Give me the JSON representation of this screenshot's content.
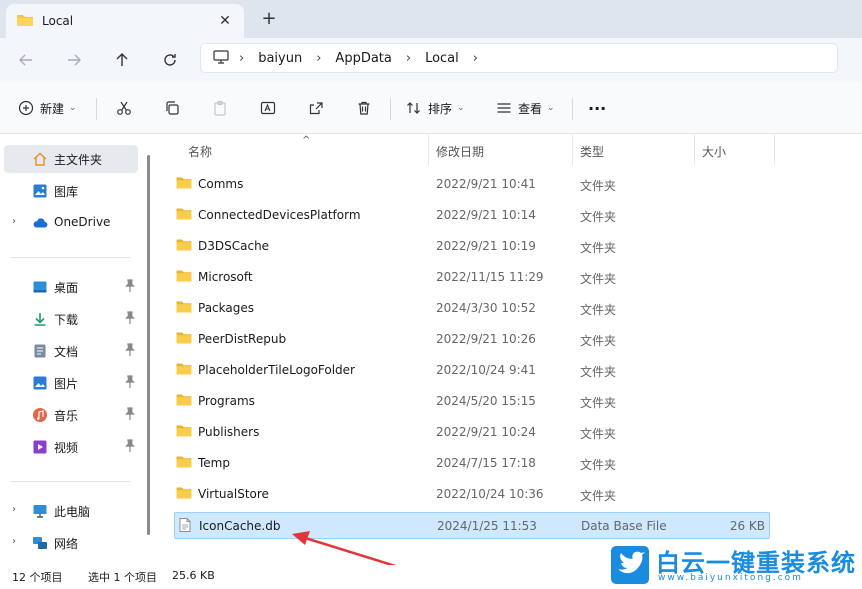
{
  "window": {
    "tab_title": "Local",
    "close_glyph": "✕",
    "new_tab_glyph": "+"
  },
  "address": {
    "crumbs": [
      "baiyun",
      "AppData",
      "Local"
    ],
    "sep": "›"
  },
  "toolbar": {
    "new_label": "新建",
    "sort_label": "排序",
    "view_label": "查看",
    "more_glyph": "···",
    "caret": "⌄"
  },
  "sidebar": {
    "home_label": "主文件夹",
    "gallery_label": "图库",
    "onedrive_label": "OneDrive",
    "desktop_label": "桌面",
    "downloads_label": "下载",
    "documents_label": "文档",
    "pictures_label": "图片",
    "music_label": "音乐",
    "videos_label": "视频",
    "thispc_label": "此电脑",
    "network_label": "网络",
    "chevron": "›"
  },
  "columns": {
    "name": "名称",
    "date": "修改日期",
    "type": "类型",
    "size": "大小",
    "sort_glyph": "^"
  },
  "files": [
    {
      "name": "Comms",
      "date": "2022/9/21 10:41",
      "type": "文件夹",
      "size": "",
      "icon": "folder-icon"
    },
    {
      "name": "ConnectedDevicesPlatform",
      "date": "2022/9/21 10:14",
      "type": "文件夹",
      "size": "",
      "icon": "folder-icon"
    },
    {
      "name": "D3DSCache",
      "date": "2022/9/21 10:19",
      "type": "文件夹",
      "size": "",
      "icon": "folder-icon"
    },
    {
      "name": "Microsoft",
      "date": "2022/11/15 11:29",
      "type": "文件夹",
      "size": "",
      "icon": "folder-icon"
    },
    {
      "name": "Packages",
      "date": "2024/3/30 10:52",
      "type": "文件夹",
      "size": "",
      "icon": "folder-icon"
    },
    {
      "name": "PeerDistRepub",
      "date": "2022/9/21 10:26",
      "type": "文件夹",
      "size": "",
      "icon": "folder-icon"
    },
    {
      "name": "PlaceholderTileLogoFolder",
      "date": "2022/10/24 9:41",
      "type": "文件夹",
      "size": "",
      "icon": "folder-icon"
    },
    {
      "name": "Programs",
      "date": "2024/5/20 15:15",
      "type": "文件夹",
      "size": "",
      "icon": "folder-icon"
    },
    {
      "name": "Publishers",
      "date": "2022/9/21 10:24",
      "type": "文件夹",
      "size": "",
      "icon": "folder-icon"
    },
    {
      "name": "Temp",
      "date": "2024/7/15 17:18",
      "type": "文件夹",
      "size": "",
      "icon": "folder-icon"
    },
    {
      "name": "VirtualStore",
      "date": "2022/10/24 10:36",
      "type": "文件夹",
      "size": "",
      "icon": "folder-icon"
    },
    {
      "name": "IconCache.db",
      "date": "2024/1/25 11:53",
      "type": "Data Base File",
      "size": "26 KB",
      "icon": "file-icon"
    }
  ],
  "status": {
    "count": "12 个项目",
    "selected": "选中 1 个项目",
    "selected_size": "25.6 KB"
  },
  "watermark": {
    "text": "白云一键重装系统",
    "url": "www.baiyunxitong.com"
  },
  "colors": {
    "accent": "#1a8ce0",
    "folder": "#f5c542",
    "selection": "#cde8ff",
    "arrow": "#e0383a"
  }
}
